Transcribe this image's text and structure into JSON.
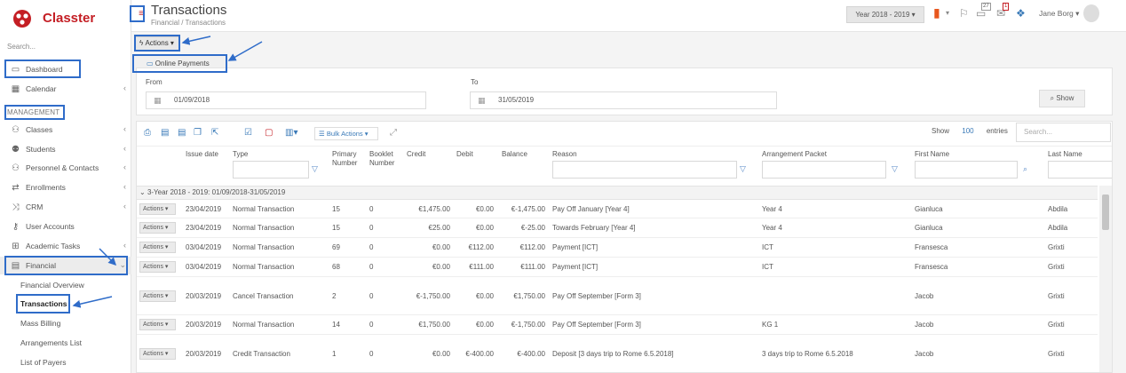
{
  "app": {
    "name": "Classter",
    "brand_color": "#c41e24"
  },
  "sidebar": {
    "search_placeholder": "Search...",
    "dashboard": "Dashboard",
    "calendar": "Calendar",
    "section_header": "MANAGEMENT",
    "items": [
      {
        "label": "Classes",
        "icon": "classes-icon"
      },
      {
        "label": "Students",
        "icon": "students-icon"
      },
      {
        "label": "Personnel & Contacts",
        "icon": "personnel-icon"
      },
      {
        "label": "Enrollments",
        "icon": "enrollments-icon"
      },
      {
        "label": "CRM",
        "icon": "crm-icon"
      },
      {
        "label": "User Accounts",
        "icon": "key-icon"
      },
      {
        "label": "Academic Tasks",
        "icon": "academic-tasks-icon"
      },
      {
        "label": "Financial",
        "icon": "financial-icon"
      }
    ],
    "sub_items": [
      "Financial Overview",
      "Transactions",
      "Mass Billing",
      "Arrangements List",
      "List of Payers"
    ]
  },
  "header": {
    "title": "Transactions",
    "breadcrumb": "Financial  /  Transactions",
    "year_select": "Year 2018 - 2019",
    "badge_messages": "27",
    "badge_alerts": "1",
    "user_name": "Jane Borg"
  },
  "actions": {
    "label": "Actions",
    "online_payments": "Online Payments"
  },
  "filter": {
    "from_label": "From",
    "from_value": "01/09/2018",
    "to_label": "To",
    "to_value": "31/05/2019",
    "show_button": "Show"
  },
  "table": {
    "bulk_actions": "Bulk Actions",
    "show_label": "Show",
    "entries_count": "100",
    "entries_label": "entries",
    "search_placeholder": "Search...",
    "columns": {
      "issue_date": "Issue date",
      "type": "Type",
      "primary_number": "Primary Number",
      "booklet_number": "Booklet Number",
      "credit": "Credit",
      "debit": "Debit",
      "balance": "Balance",
      "reason": "Reason",
      "arrangement_packet": "Arrangement Packet",
      "first_name": "First Name",
      "last_name": "Last Name"
    },
    "group_label": "3-Year 2018 - 2019: 01/09/2018-31/05/2019",
    "row_action_label": "Actions",
    "rows": [
      {
        "date": "23/04/2019",
        "type": "Normal Transaction",
        "primary": "15",
        "booklet": "0",
        "credit": "€1,475.00",
        "debit": "€0.00",
        "balance": "€-1,475.00",
        "reason": "Pay Off January [Year 4]",
        "packet": "Year 4",
        "first": "Gianluca",
        "last": "Abdila"
      },
      {
        "date": "23/04/2019",
        "type": "Normal Transaction",
        "primary": "15",
        "booklet": "0",
        "credit": "€25.00",
        "debit": "€0.00",
        "balance": "€-25.00",
        "reason": "Towards February [Year 4]",
        "packet": "Year 4",
        "first": "Gianluca",
        "last": "Abdila"
      },
      {
        "date": "03/04/2019",
        "type": "Normal Transaction",
        "primary": "69",
        "booklet": "0",
        "credit": "€0.00",
        "debit": "€112.00",
        "balance": "€112.00",
        "reason": "Payment [ICT]",
        "packet": "ICT",
        "first": "Fransesca",
        "last": "Grixti"
      },
      {
        "date": "03/04/2019",
        "type": "Normal Transaction",
        "primary": "68",
        "booklet": "0",
        "credit": "€0.00",
        "debit": "€111.00",
        "balance": "€111.00",
        "reason": "Payment [ICT]",
        "packet": "ICT",
        "first": "Fransesca",
        "last": "Grixti"
      },
      {
        "date": "20/03/2019",
        "type": "Cancel Transaction",
        "primary": "2",
        "booklet": "0",
        "credit": "€-1,750.00",
        "debit": "€0.00",
        "balance": "€1,750.00",
        "reason": "Pay Off September [Form 3]",
        "packet": "",
        "first": "Jacob",
        "last": "Grixti"
      },
      {
        "date": "20/03/2019",
        "type": "Normal Transaction",
        "primary": "14",
        "booklet": "0",
        "credit": "€1,750.00",
        "debit": "€0.00",
        "balance": "€-1,750.00",
        "reason": "Pay Off September [Form 3]",
        "packet": "KG 1",
        "first": "Jacob",
        "last": "Grixti"
      },
      {
        "date": "20/03/2019",
        "type": "Credit Transaction",
        "primary": "1",
        "booklet": "0",
        "credit": "€0.00",
        "debit": "€-400.00",
        "balance": "€-400.00",
        "reason": "Deposit [3 days trip to Rome 6.5.2018]",
        "packet": "3 days trip to Rome 6.5.2018",
        "first": "Jacob",
        "last": "Grixti"
      }
    ]
  },
  "colors": {
    "annotation": "#2f6cc9",
    "link": "#3a7ab8"
  }
}
